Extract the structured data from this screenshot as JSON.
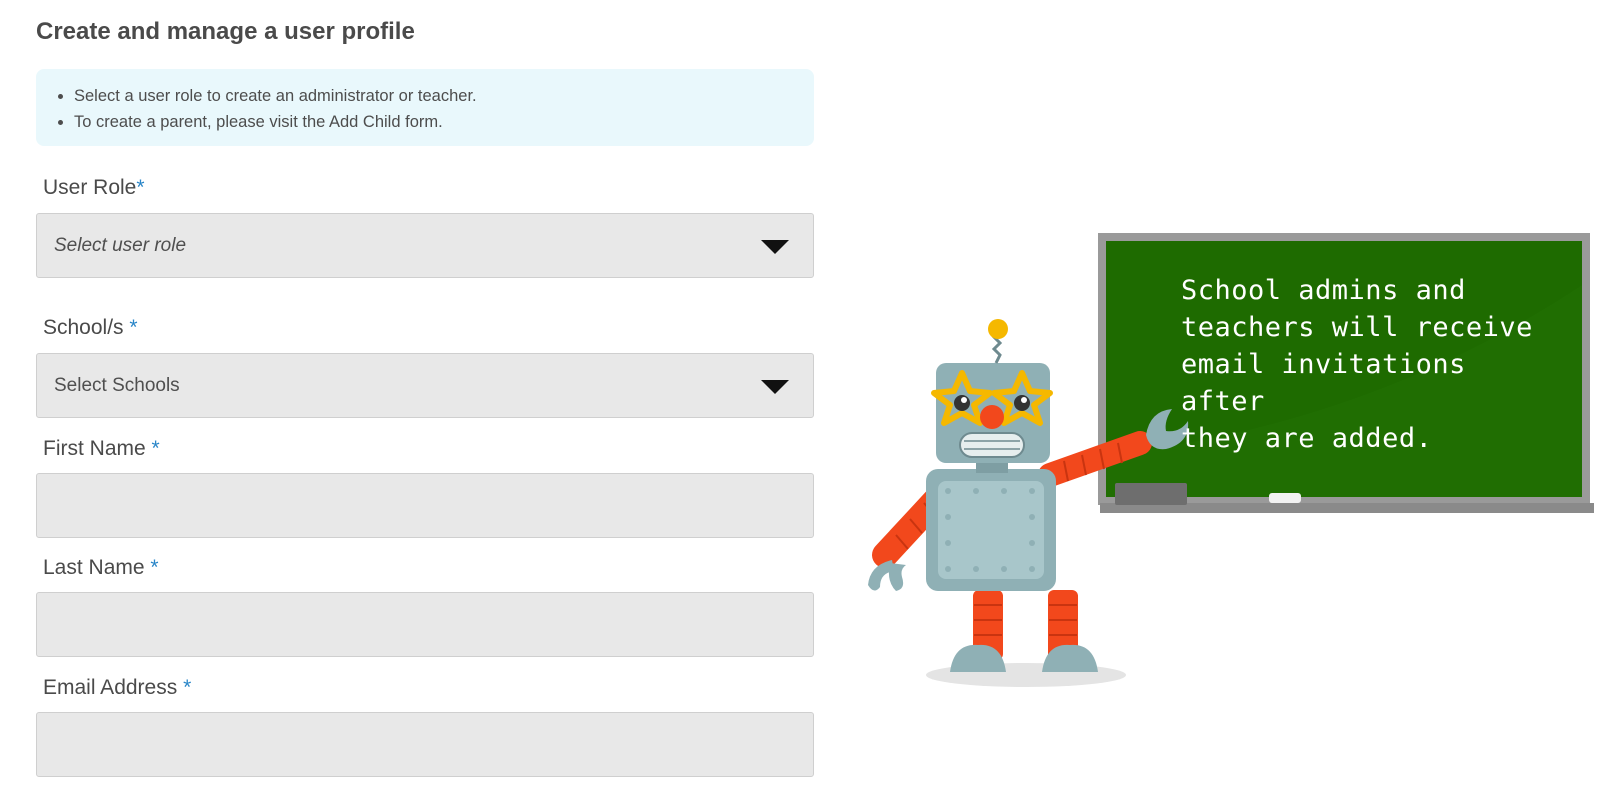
{
  "page": {
    "title": "Create and manage a user profile"
  },
  "info": {
    "items": [
      "Select a user role to create an administrator or teacher.",
      "To create a parent, please visit the Add Child form."
    ]
  },
  "form": {
    "user_role": {
      "label": "User Role",
      "required_mark": "*",
      "value": "Select user role"
    },
    "schools": {
      "label": "School/s ",
      "required_mark": "*",
      "value": "Select Schools"
    },
    "first_name": {
      "label": "First Name ",
      "required_mark": "*",
      "value": ""
    },
    "last_name": {
      "label": "Last Name ",
      "required_mark": "*",
      "value": ""
    },
    "email": {
      "label": "Email Address ",
      "required_mark": "*",
      "value": ""
    }
  },
  "illustration": {
    "board_lines": [
      "School admins and",
      "teachers will receive",
      "email invitations after",
      "they are added."
    ],
    "board_color": "#1e6b00",
    "accent_color": "#2a86c8"
  }
}
